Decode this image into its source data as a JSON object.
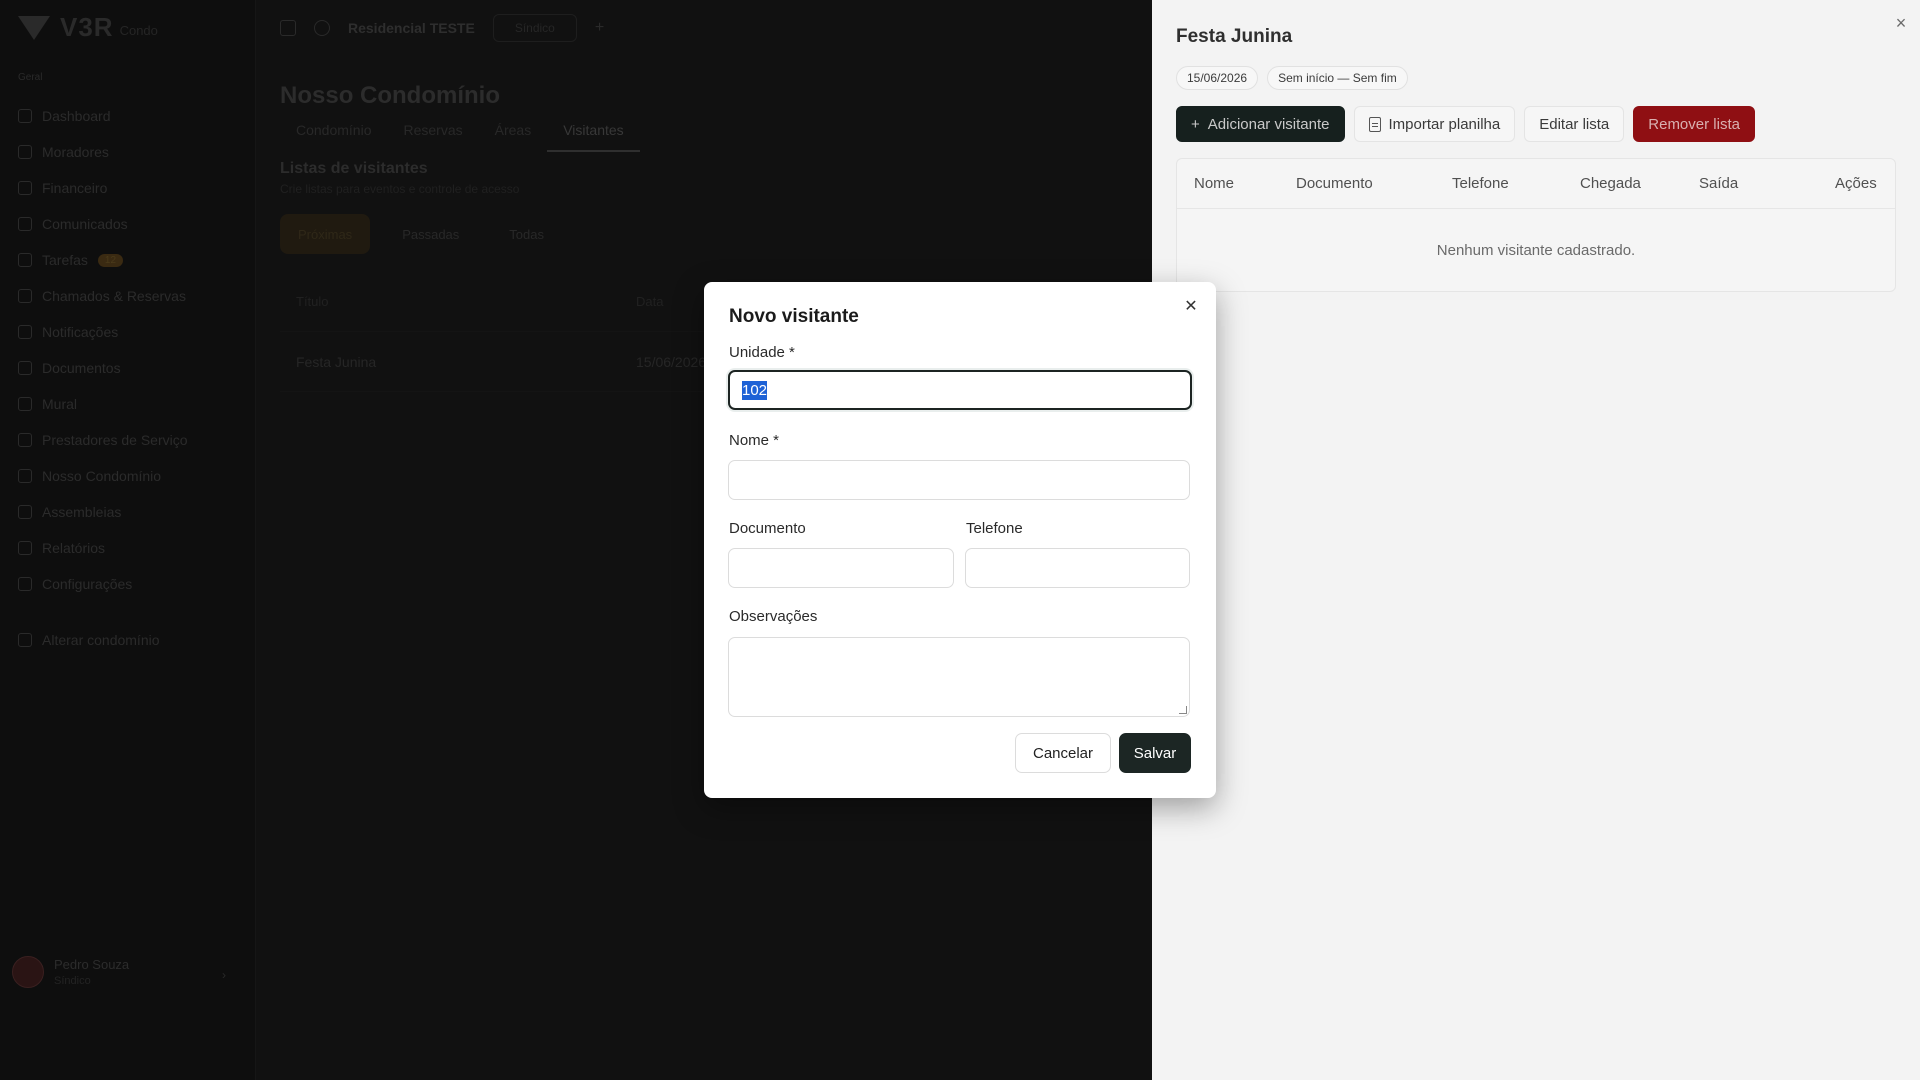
{
  "sidebar": {
    "brand": "V3R",
    "brand_sub": "Condo",
    "section_label": "Geral",
    "items": [
      {
        "label": "Dashboard",
        "icon": "dashboard-icon"
      },
      {
        "label": "Moradores",
        "icon": "users-icon"
      },
      {
        "label": "Financeiro",
        "icon": "dollar-icon"
      },
      {
        "label": "Comunicados",
        "icon": "megaphone-icon"
      },
      {
        "label": "Tarefas",
        "icon": "tasks-icon",
        "badge": "12"
      },
      {
        "label": "Chamados & Reservas",
        "icon": "calendar-icon"
      },
      {
        "label": "Notificações",
        "icon": "bell-icon"
      },
      {
        "label": "Documentos",
        "icon": "folder-icon"
      },
      {
        "label": "Mural",
        "icon": "board-icon"
      },
      {
        "label": "Prestadores de Serviço",
        "icon": "tools-icon"
      },
      {
        "label": "Nosso Condomínio",
        "icon": "building-icon"
      },
      {
        "label": "Assembleias",
        "icon": "vote-icon"
      },
      {
        "label": "Relatórios",
        "icon": "chart-icon"
      },
      {
        "label": "Configurações",
        "icon": "gear-icon"
      }
    ],
    "extra_item": "Alterar condomínio",
    "user": {
      "name": "Pedro Souza",
      "role": "Síndico"
    }
  },
  "topbar": {
    "title": "Residencial TESTE",
    "pill": "Síndico"
  },
  "page": {
    "title": "Nosso Condomínio",
    "tabs": [
      "Condomínio",
      "Reservas",
      "Áreas",
      "Visitantes"
    ],
    "active_tab": "Visitantes",
    "section_title": "Listas de visitantes",
    "section_subtitle": "Crie listas para eventos e controle de acesso",
    "filters": [
      "Próximas",
      "Passadas",
      "Todas"
    ],
    "table_head": [
      "Título",
      "Data"
    ],
    "rows": [
      [
        "Festa Junina",
        "15/06/2026"
      ]
    ]
  },
  "drawer": {
    "title": "Festa Junina",
    "chips": [
      "15/06/2026",
      "Sem início — Sem fim"
    ],
    "actions": {
      "add": "Adicionar visitante",
      "import": "Importar planilha",
      "edit": "Editar lista",
      "remove": "Remover lista"
    },
    "columns": [
      "Nome",
      "Documento",
      "Telefone",
      "Chegada",
      "Saída",
      "Ações"
    ],
    "empty": "Nenhum visitante cadastrado.",
    "colors": {
      "primary": "#16201e",
      "danger": "#8f0f13"
    }
  },
  "modal": {
    "title": "Novo visitante",
    "unit_label": "Unidade *",
    "unit_value": "102",
    "name_label": "Nome *",
    "name_value": "",
    "doc_label": "Documento",
    "doc_value": "",
    "phone_label": "Telefone",
    "phone_value": "",
    "notes_label": "Observações",
    "notes_value": "",
    "cancel": "Cancelar",
    "save": "Salvar"
  }
}
